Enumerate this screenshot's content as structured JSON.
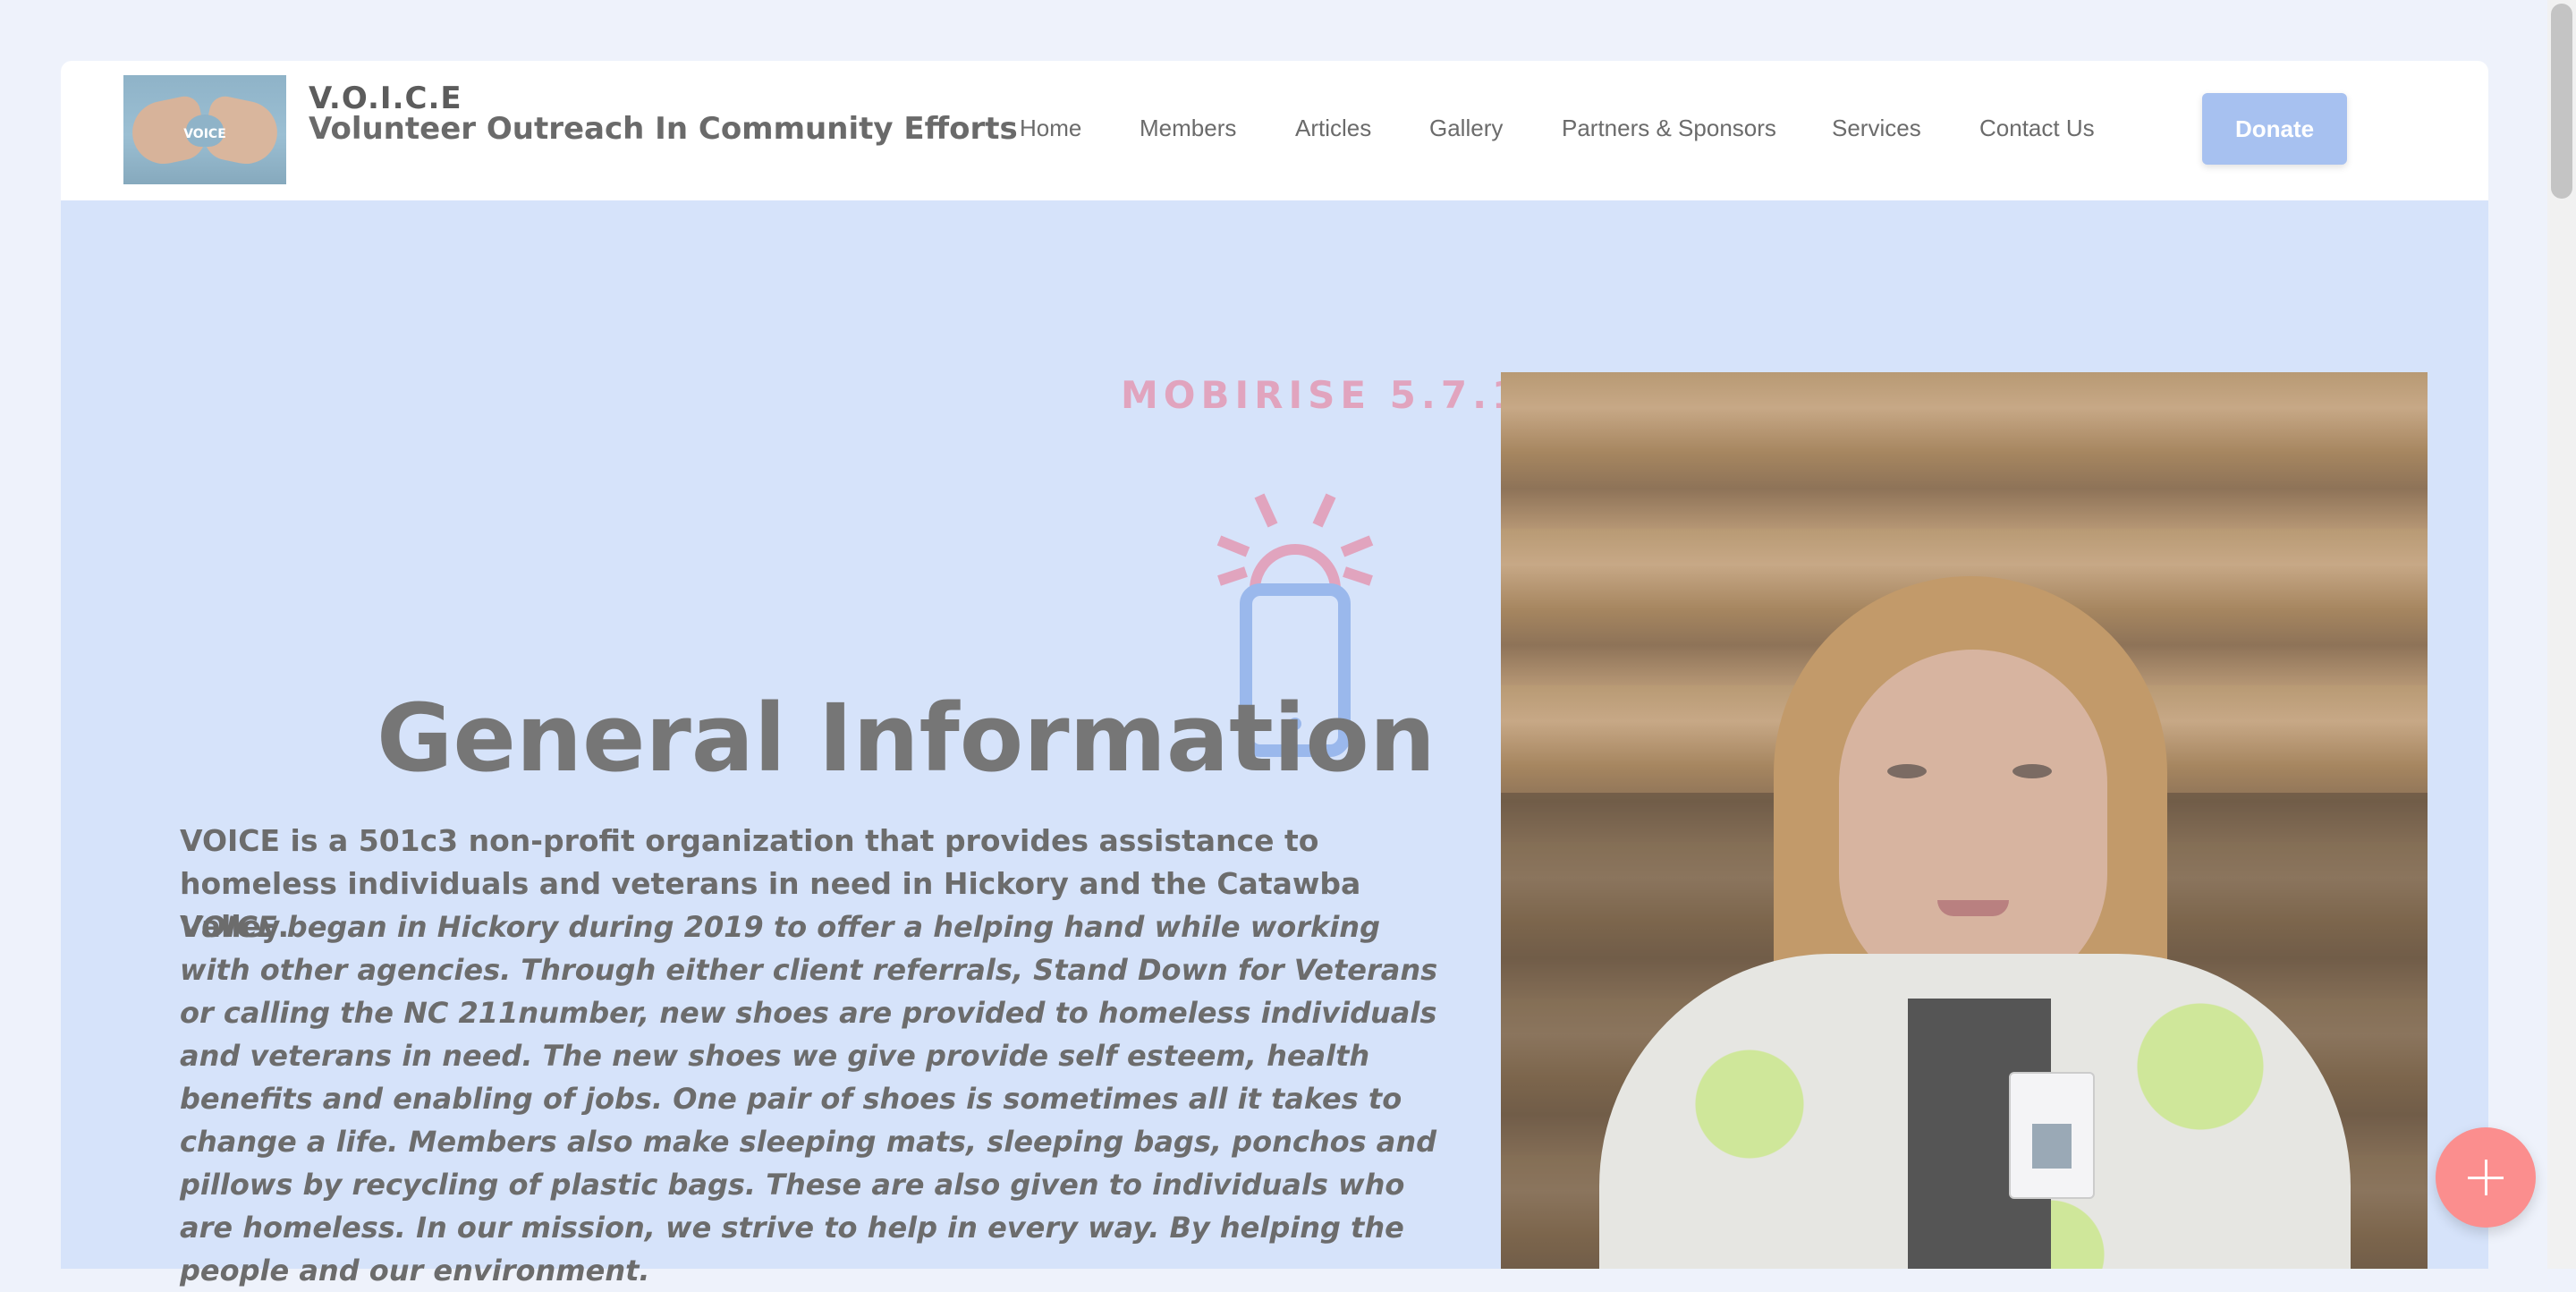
{
  "header": {
    "logo_text": "VOICE",
    "brand_short": "V.O.I.C.E",
    "brand_full": "Volunteer Outreach In Community Efforts",
    "nav": [
      {
        "label": "Home"
      },
      {
        "label": "Members"
      },
      {
        "label": "Articles"
      },
      {
        "label": "Gallery"
      },
      {
        "label": "Partners & Sponsors"
      },
      {
        "label": "Services"
      },
      {
        "label": "Contact Us"
      }
    ],
    "donate_label": "Donate"
  },
  "hero": {
    "badge_text": "MOBIRISE  5.7.12",
    "icon": "mobile-phone-alert-icon",
    "title": "General Information",
    "intro": "VOICE is a 501c3 non-profit organization that provides assistance to homeless individuals and veterans in need in Hickory and the Catawba Valley.",
    "story": "VOICE began in Hickory during 2019 to offer a helping hand while working with other agencies. Through either client referrals, Stand Down for Veterans or calling the NC 211number, new shoes are provided to homeless individuals and veterans in need. The new shoes we give provide self esteem, health benefits and enabling of jobs. One pair of shoes is sometimes all it takes to change a life. Members also make sleeping mats, sleeping bags, ponchos and pillows by recycling of plastic bags. These are also given to individuals who are homeless. In our mission, we strive to help in every way. By helping the people and our environment."
  },
  "fab": {
    "icon": "plus-icon"
  },
  "colors": {
    "page_bg": "#eef2fb",
    "hero_bg": "#d6e3fa",
    "accent_blue": "#a7c1f0",
    "accent_pink": "#e1a4be",
    "fab_red": "#fb8e8e"
  }
}
